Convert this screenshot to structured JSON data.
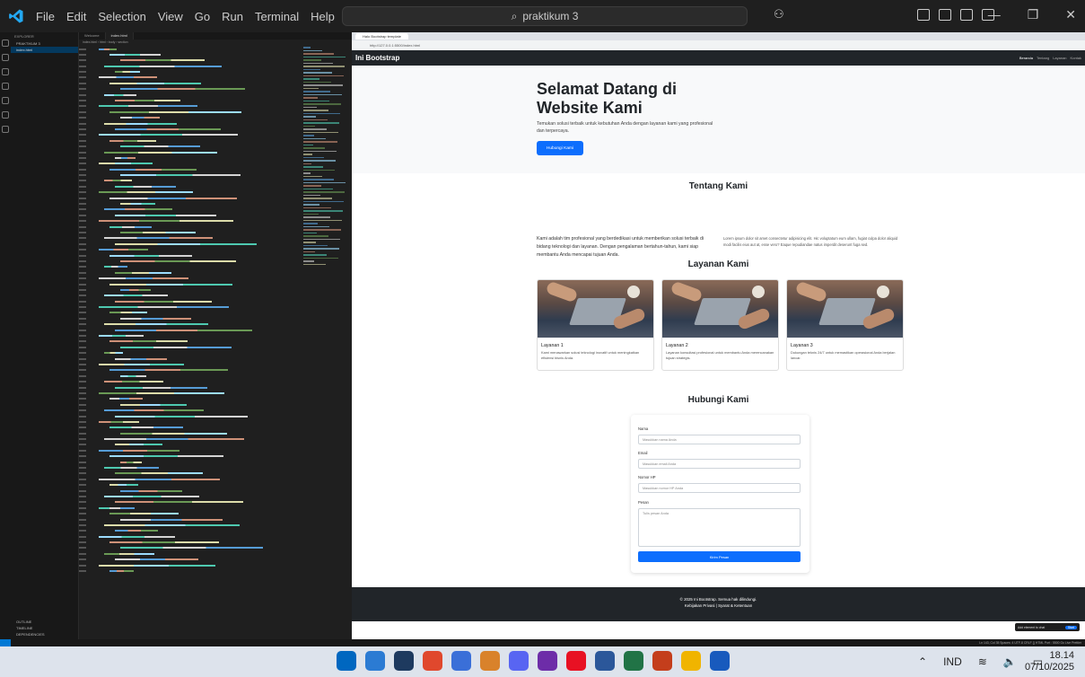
{
  "vscode": {
    "menu": [
      "File",
      "Edit",
      "Selection",
      "View",
      "Go",
      "Run",
      "Terminal",
      "Help"
    ],
    "search": "praktikum 3",
    "tabs": [
      "Welcome",
      "index.html"
    ],
    "explorer": {
      "header": "EXPLORER",
      "root": "PRAKTIKUM 3",
      "file": "index.html",
      "sections": [
        "OUTLINE",
        "TIMELINE",
        "DEPENDENCIES"
      ]
    },
    "accent": "#0078d4"
  },
  "browser": {
    "tab": "Halo Bootstrap template",
    "url": "http://127.0.0.1:5500/index.html",
    "navbar": {
      "brand": "Ini Bootstrap",
      "links": [
        "Beranda",
        "Tentang",
        "Layanan",
        "Kontak"
      ]
    },
    "hero": {
      "title": "Selamat Datang di Website Kami",
      "text": "Temukan solusi terbaik untuk kebutuhan Anda dengan layanan kami yang profesional dan terpercaya.",
      "button": "Hubungi Kami"
    },
    "about": {
      "title": "Tentang Kami",
      "left": "Kami adalah tim profesional yang berdedikasi untuk memberikan solusi terbaik di bidang teknologi dan layanan. Dengan pengalaman bertahun-tahun, kami siap membantu Anda mencapai tujuan Anda.",
      "right": "Lorem ipsum dolor sit amet consectetur adipisicing elit. Hic voluptatum eum ullam, fugiat culpa dolor aliquid modi facilis eius aut at, esse vero? Eaque repudiandae natus imperdit deserunt fuga sed."
    },
    "services": {
      "title": "Layanan Kami",
      "cards": [
        {
          "title": "Layanan 1",
          "text": "Kami menawarkan solusi teknologi inovatif untuk meningkatkan efisiensi bisnis Anda."
        },
        {
          "title": "Layanan 2",
          "text": "Layanan konsultasi profesional untuk membantu Anda merencanakan tujuan strategis."
        },
        {
          "title": "Layanan 3",
          "text": "Dukungan teknis 24/7 untuk memastikan operasional Anda berjalan lancar."
        }
      ]
    },
    "contact": {
      "title": "Hubungi Kami",
      "fields": [
        {
          "label": "Nama",
          "placeholder": "Masukkan nama Anda"
        },
        {
          "label": "Email",
          "placeholder": "Masukkan email Anda"
        },
        {
          "label": "Nomor HP",
          "placeholder": "Masukkan nomor HP Anda"
        }
      ],
      "message_label": "Pesan",
      "message_placeholder": "Tulis pesan Anda",
      "submit": "Kirim Pesan"
    },
    "footer": {
      "copy": "© 2025 Ini Bootstrap. Semua hak dilindungi.",
      "links": "Kebijakan Privasi | Syarat & Ketentuan"
    },
    "add_element": "Add element to chat",
    "add_element_btn": "Start"
  },
  "statusbar": {
    "right": "Ln 143, Col 35  Spaces: 4  UTF-8  CRLF  {} HTML  Port : 5500  Go Live  Prettier"
  },
  "taskbar": {
    "lang": "IND",
    "time": "18.14",
    "date": "07/10/2025",
    "app_colors": [
      "#0067c0",
      "#2b7bd3",
      "#1e3a5f",
      "#e0482d",
      "#3a6fd8",
      "#d9822b",
      "#5865f2",
      "#6d2ca8",
      "#e81123",
      "#2b579a",
      "#217346",
      "#c43e1c",
      "#f0b400",
      "#185abd"
    ]
  }
}
